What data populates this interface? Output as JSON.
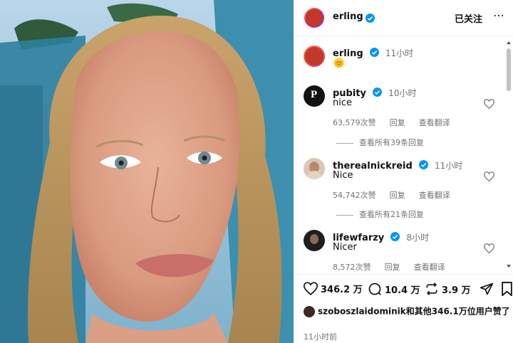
{
  "header": {
    "username": "erling",
    "follow_label": "已关注",
    "more": "⋯"
  },
  "caption": {
    "username": "erling",
    "time": "11小时",
    "emoji": "🌞"
  },
  "comments": [
    {
      "username": "pubity",
      "time": "10小时",
      "text": "nice",
      "likes": "63,579次赞",
      "reply": "回复",
      "translate": "查看翻译",
      "view_replies": "查看所有39条回复"
    },
    {
      "username": "therealnickreid",
      "time": "11小时",
      "text": "Nice",
      "likes": "54,742次赞",
      "reply": "回复",
      "translate": "查看翻译",
      "view_replies": "查看所有21条回复"
    },
    {
      "username": "lifewfarzy",
      "time": "8小时",
      "text": "Nicer",
      "likes": "8,572次赞",
      "reply": "回复",
      "translate": "查看翻译"
    }
  ],
  "actions": {
    "likes": "346.2 万",
    "comments": "10.4 万",
    "reposts": "3.9 万"
  },
  "liked_by": {
    "username": "szoboszlaidominik",
    "rest": "和其他346.1万位用户赞了"
  },
  "post_time": "11小时前",
  "colors": {
    "verified": "#0095f6",
    "muted": "#737373"
  }
}
